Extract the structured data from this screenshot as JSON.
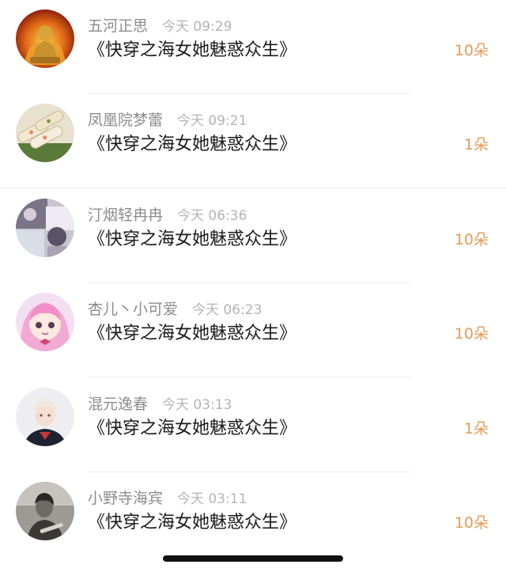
{
  "gift_rows": [
    {
      "name": "五河正思",
      "time": "今天 09:29",
      "title": "《快穿之海女她魅惑众生》",
      "gift": "10朵",
      "avatar_icon": "buddha-avatar-icon"
    },
    {
      "name": "凤凰院梦蕾",
      "time": "今天 09:21",
      "title": "《快穿之海女她魅惑众生》",
      "gift": "1朵",
      "avatar_icon": "food-rolls-avatar-icon"
    },
    {
      "name": "汀烟轻冉冉",
      "time": "今天 06:36",
      "title": "《快穿之海女她魅惑众生》",
      "gift": "10朵",
      "avatar_icon": "collage-avatar-icon"
    },
    {
      "name": "杏儿丶小可爱",
      "time": "今天 06:23",
      "title": "《快穿之海女她魅惑众生》",
      "gift": "10朵",
      "avatar_icon": "anime-girl-avatar-icon"
    },
    {
      "name": "混元逸春",
      "time": "今天 03:13",
      "title": "《快穿之海女她魅惑众生》",
      "gift": "1朵",
      "avatar_icon": "person-portrait-avatar-icon"
    },
    {
      "name": "小野寺海宾",
      "time": "今天 03:11",
      "title": "《快穿之海女她魅惑众生》",
      "gift": "10朵",
      "avatar_icon": "grayscale-person-avatar-icon"
    }
  ],
  "colors": {
    "name": "#8c8c8c",
    "time": "#b4b4b4",
    "title": "#1a1a1a",
    "gift": "#e69b57"
  }
}
